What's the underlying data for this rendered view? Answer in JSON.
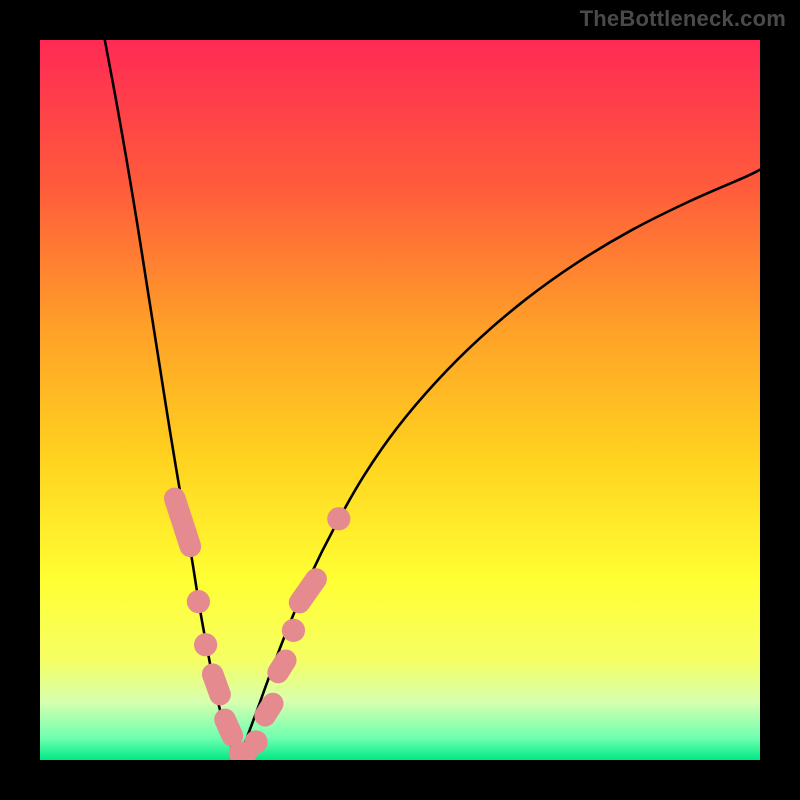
{
  "watermark": "TheBottleneck.com",
  "chart_data": {
    "type": "line",
    "title": "",
    "xlabel": "",
    "ylabel": "",
    "xlim": [
      0,
      100
    ],
    "ylim": [
      0,
      100
    ],
    "grid": false,
    "legend": false,
    "background_gradient_stops": [
      {
        "offset": 0.0,
        "color": "#ff2a55"
      },
      {
        "offset": 0.2,
        "color": "#ff5a3c"
      },
      {
        "offset": 0.4,
        "color": "#ffa028"
      },
      {
        "offset": 0.58,
        "color": "#ffd21f"
      },
      {
        "offset": 0.75,
        "color": "#ffff33"
      },
      {
        "offset": 0.86,
        "color": "#f6ff63"
      },
      {
        "offset": 0.92,
        "color": "#d6ffb0"
      },
      {
        "offset": 0.97,
        "color": "#6dffb0"
      },
      {
        "offset": 1.0,
        "color": "#00e884"
      }
    ],
    "series": [
      {
        "name": "left-branch",
        "x": [
          9.0,
          10.5,
          12.0,
          13.5,
          15.0,
          16.5,
          18.0,
          19.5,
          21.0,
          22.2,
          23.4,
          24.5,
          25.6,
          26.6,
          27.5
        ],
        "y": [
          100.0,
          92.0,
          83.5,
          74.5,
          65.0,
          55.5,
          46.0,
          37.0,
          28.5,
          21.0,
          14.5,
          9.0,
          4.8,
          1.8,
          0.0
        ]
      },
      {
        "name": "right-branch",
        "x": [
          27.5,
          28.5,
          30.0,
          32.0,
          34.5,
          37.5,
          41.0,
          45.0,
          49.5,
          55.0,
          61.0,
          67.5,
          74.5,
          82.0,
          90.0,
          98.0,
          100.0
        ],
        "y": [
          0.0,
          2.5,
          6.5,
          12.0,
          18.5,
          25.5,
          32.5,
          39.5,
          46.0,
          52.5,
          58.5,
          64.0,
          69.0,
          73.5,
          77.5,
          81.0,
          82.0
        ]
      }
    ],
    "markers": [
      {
        "shape": "capsule",
        "cx": 19.8,
        "cy": 33.0,
        "len": 10.0,
        "angle": -72
      },
      {
        "shape": "circle",
        "cx": 22.0,
        "cy": 22.0,
        "r": 1.7
      },
      {
        "shape": "circle",
        "cx": 23.0,
        "cy": 16.0,
        "r": 1.7
      },
      {
        "shape": "capsule",
        "cx": 24.5,
        "cy": 10.5,
        "len": 6.0,
        "angle": -70
      },
      {
        "shape": "capsule",
        "cx": 26.2,
        "cy": 4.5,
        "len": 5.5,
        "angle": -66
      },
      {
        "shape": "capsule",
        "cx": 28.2,
        "cy": 1.0,
        "len": 4.0,
        "angle": 0
      },
      {
        "shape": "circle",
        "cx": 30.0,
        "cy": 2.5,
        "r": 1.7
      },
      {
        "shape": "capsule",
        "cx": 31.8,
        "cy": 7.0,
        "len": 5.0,
        "angle": 58
      },
      {
        "shape": "capsule",
        "cx": 33.6,
        "cy": 13.0,
        "len": 5.0,
        "angle": 58
      },
      {
        "shape": "circle",
        "cx": 35.2,
        "cy": 18.0,
        "r": 1.7
      },
      {
        "shape": "capsule",
        "cx": 37.2,
        "cy": 23.5,
        "len": 7.0,
        "angle": 55
      },
      {
        "shape": "circle",
        "cx": 41.5,
        "cy": 33.5,
        "r": 1.7
      }
    ],
    "marker_style": {
      "fill": "#e58b8f",
      "rx": 10
    },
    "curve_style": {
      "stroke": "#000000",
      "width": 2.6
    }
  }
}
